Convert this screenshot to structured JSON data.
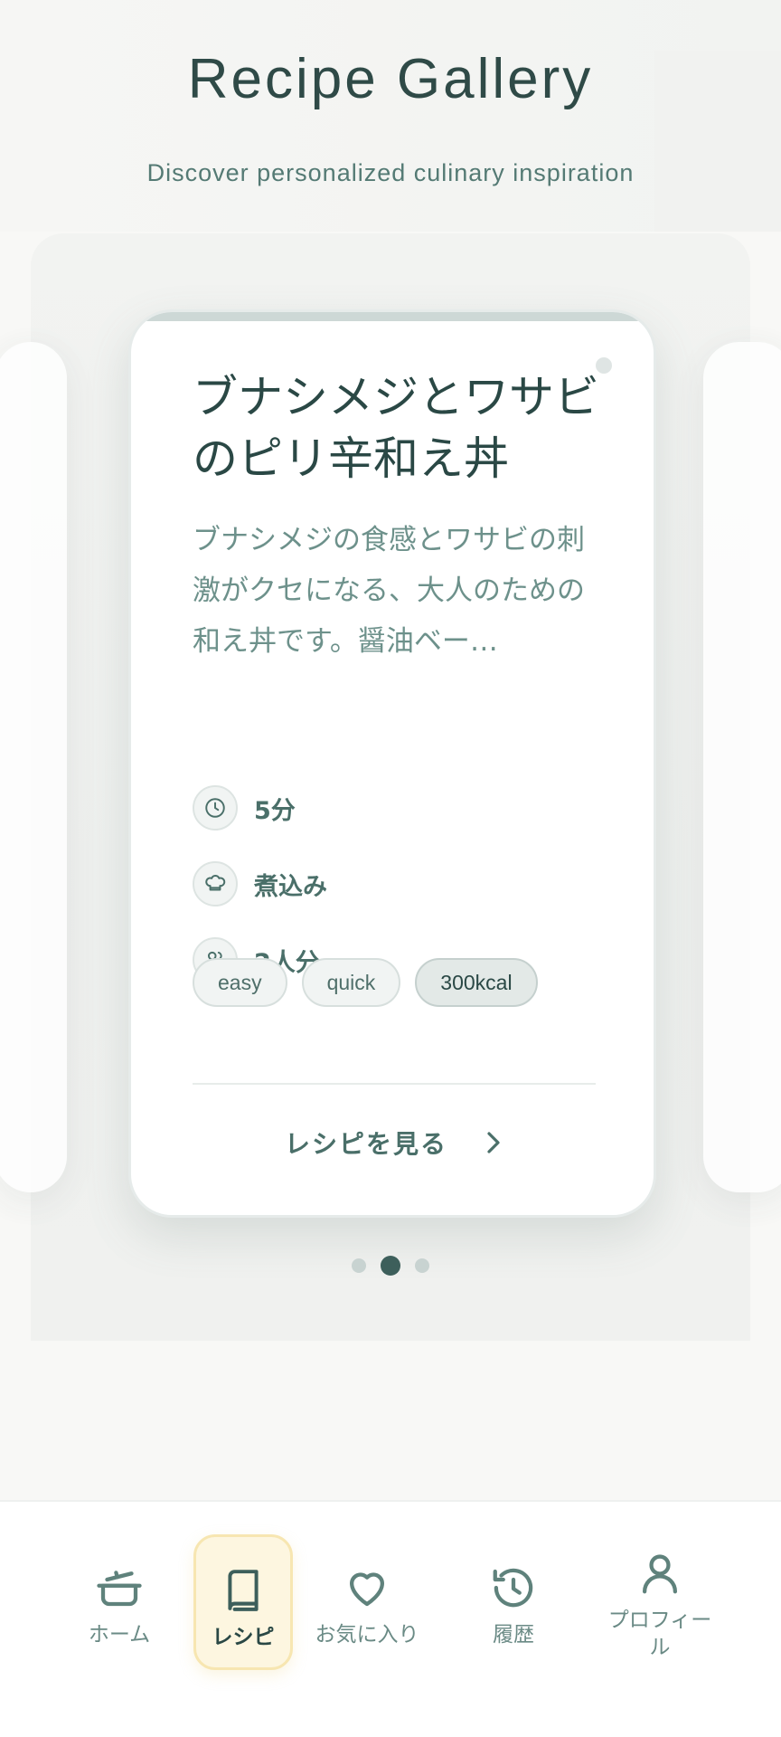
{
  "header": {
    "title": "Recipe Gallery",
    "subtitle": "Discover personalized culinary inspiration"
  },
  "card": {
    "title": "ブナシメジとワサビのピリ辛和え丼",
    "description": "ブナシメジの食感とワサビの刺激がクセになる、大人のための和え丼です。醤油ベー…",
    "meta": [
      {
        "icon": "clock-icon",
        "text": "5分"
      },
      {
        "icon": "chef-hat-icon",
        "text": "煮込み"
      },
      {
        "icon": "people-icon",
        "text": "2人分"
      }
    ],
    "tags": [
      "easy",
      "quick",
      "300kcal"
    ],
    "view_label": "レシピを見る"
  },
  "pager": {
    "count": 3,
    "active_index": 1
  },
  "nav": {
    "items": [
      {
        "label": "ホーム",
        "icon": "pot-icon"
      },
      {
        "label": "レシピ",
        "icon": "book-icon",
        "active": true
      },
      {
        "label": "お気に入り",
        "icon": "heart-icon"
      },
      {
        "label": "履歴",
        "icon": "history-icon"
      },
      {
        "label": "プロフィール",
        "icon": "user-icon"
      }
    ]
  },
  "colors": {
    "accent": "#2f4a47",
    "muted": "#6d918b",
    "nav_active_bg": "#fdf6e0"
  }
}
